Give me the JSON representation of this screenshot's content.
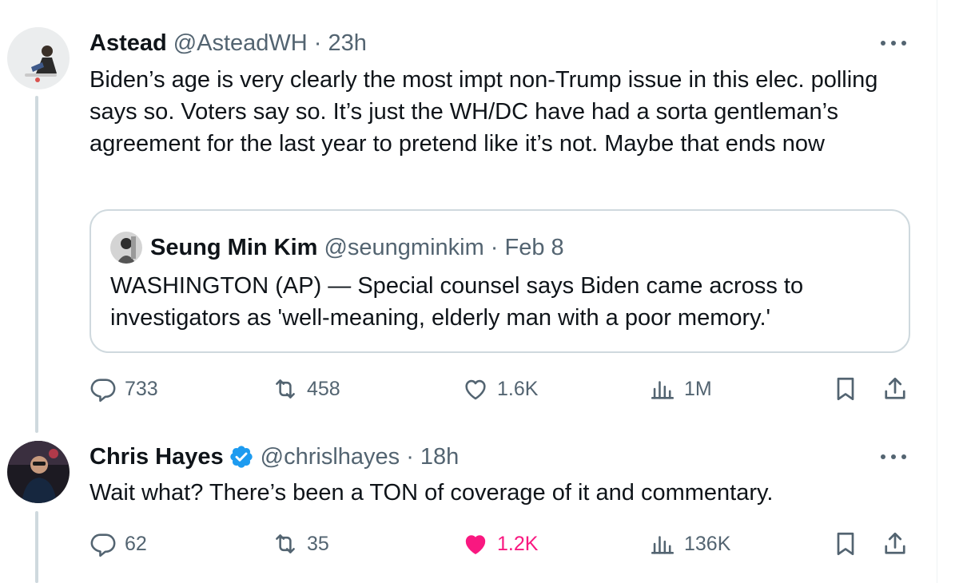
{
  "tweets": [
    {
      "name": "Astead",
      "handle": "@AsteadWH",
      "time": "23h",
      "meta": "@AsteadWH · 23h",
      "text": "Biden’s age is very clearly the  most impt non-Trump issue in this elec. polling says so. Voters say so. It’s just the WH/DC have had a sorta gentleman’s agreement for the last year to pretend like it’s not. Maybe that ends now",
      "quote": {
        "name": "Seung Min Kim",
        "handle": "@seungminkim",
        "date": "Feb 8",
        "meta": "@seungminkim · Feb 8",
        "text": "WASHINGTON (AP) — Special counsel says Biden came across to investigators as 'well-meaning, elderly man with a poor memory.'"
      },
      "stats": {
        "replies": "733",
        "reposts": "458",
        "likes": "1.6K",
        "views": "1M"
      },
      "liked": false
    },
    {
      "name": "Chris Hayes",
      "handle": "@chrislhayes",
      "time": "18h",
      "meta": "@chrislhayes · 18h",
      "verified": true,
      "text": "Wait what? There’s been a TON of coverage of it and commentary.",
      "stats": {
        "replies": "62",
        "reposts": "35",
        "likes": "1.2K",
        "views": "136K"
      },
      "liked": true
    }
  ],
  "icons": [
    "reply-icon",
    "repost-icon",
    "like-icon",
    "views-icon",
    "bookmark-icon",
    "share-icon",
    "more-icon",
    "verified-badge-icon"
  ],
  "colors": {
    "text": "#0f1419",
    "secondary": "#536471",
    "like_active": "#f91880",
    "verified": "#1d9bf0",
    "border": "#cfd9de"
  }
}
